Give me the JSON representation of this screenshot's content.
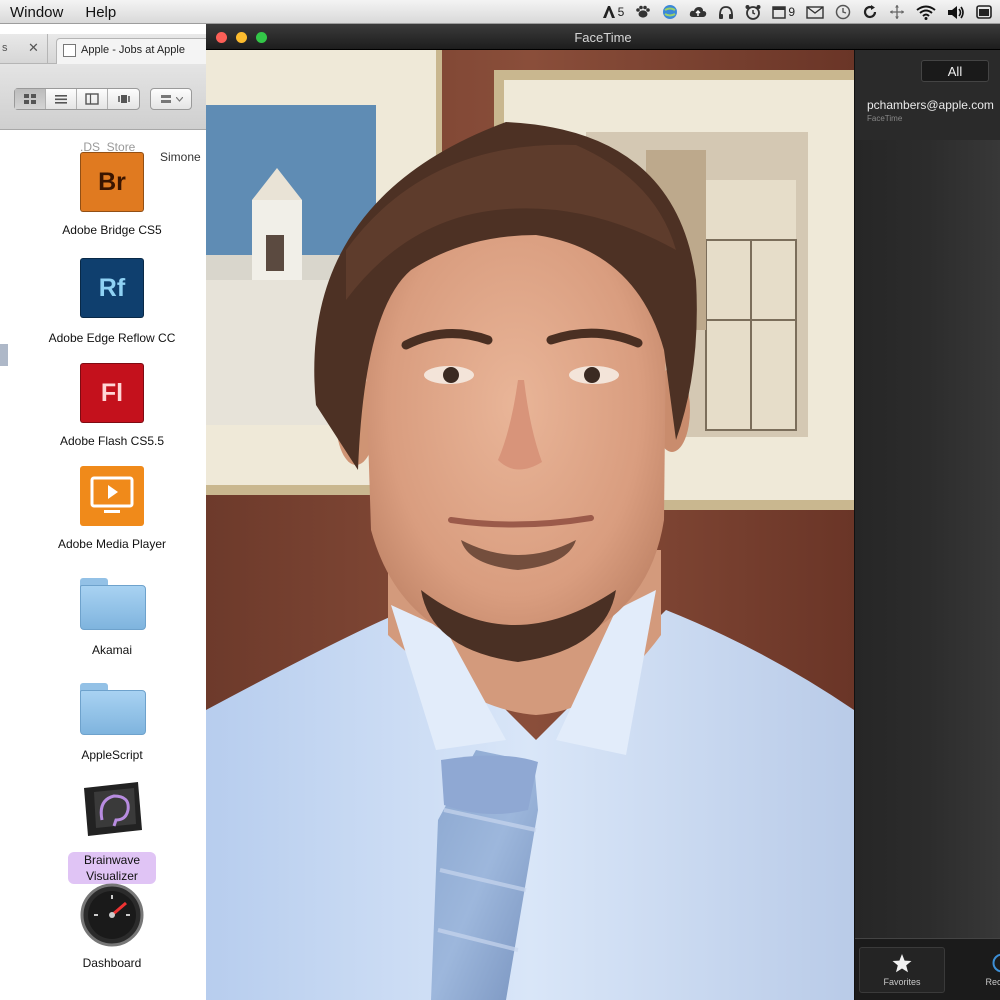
{
  "menubar": {
    "menus": [
      "Window",
      "Help"
    ],
    "tray": [
      {
        "icon": "adobe-icon",
        "text": "5"
      },
      {
        "icon": "paw-icon",
        "text": ""
      },
      {
        "icon": "globe-icon",
        "text": ""
      },
      {
        "icon": "cloud-upload-icon",
        "text": ""
      },
      {
        "icon": "headphones-icon",
        "text": ""
      },
      {
        "icon": "alarm-clock-icon",
        "text": ""
      },
      {
        "icon": "calendar-icon",
        "text": "9"
      },
      {
        "icon": "mail-icon",
        "text": ""
      },
      {
        "icon": "time-machine-icon",
        "text": ""
      },
      {
        "icon": "sync-icon",
        "text": ""
      },
      {
        "icon": "move-icon",
        "text": ""
      },
      {
        "icon": "wifi-icon",
        "text": ""
      },
      {
        "icon": "volume-icon",
        "text": ""
      },
      {
        "icon": "window-icon",
        "text": ""
      }
    ]
  },
  "finder": {
    "tabs": {
      "left_ellipsis": "s",
      "active_label": "Apple - Jobs at Apple"
    },
    "ds_store": ".DS_Store",
    "simone": "Simone",
    "items": [
      {
        "name": "Adobe Bridge CS5",
        "abbr": "Br",
        "kind": "app",
        "bg": "#e07a20",
        "fg": "#3a1500"
      },
      {
        "name": "Adobe Edge Reflow CC",
        "abbr": "Rf",
        "kind": "app",
        "bg": "#0f3f6e",
        "fg": "#8fd2f4"
      },
      {
        "name": "Adobe Flash CS5.5",
        "abbr": "Fl",
        "kind": "app",
        "bg": "#c4111c",
        "fg": "#ffd6d6"
      },
      {
        "name": "Adobe Media Player",
        "abbr": "",
        "kind": "media",
        "bg": "#f08a1a",
        "fg": "#ffffff"
      },
      {
        "name": "Akamai",
        "abbr": "",
        "kind": "folder"
      },
      {
        "name": "AppleScript",
        "abbr": "",
        "kind": "folder"
      },
      {
        "name": "Brainwave Visualizer",
        "abbr": "",
        "kind": "brain"
      },
      {
        "name": "Dashboard",
        "abbr": "",
        "kind": "dashboard"
      }
    ]
  },
  "facetime": {
    "title": "FaceTime",
    "filter_label": "All",
    "contact_email": "pchambers@apple.com",
    "contact_sub": "FaceTime",
    "favorites_label": "Favorites",
    "recents_label": "Recents"
  },
  "colors": {
    "close": "#fc5f57",
    "minimize": "#fdbc2e",
    "zoom": "#33c748",
    "wall": "#7a4433",
    "shirt": "#c8daf3"
  }
}
